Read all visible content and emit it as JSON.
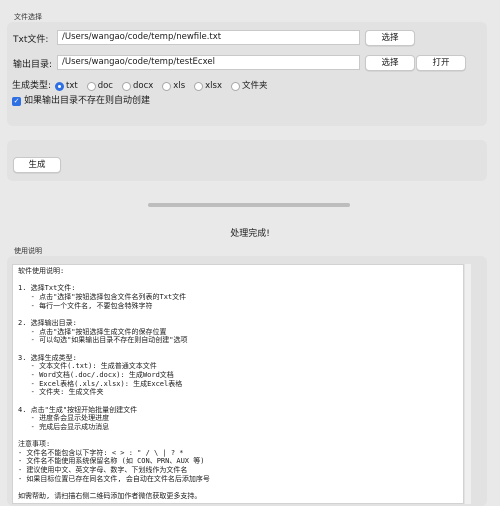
{
  "file_group": {
    "label": "文件选择",
    "txt_label": "Txt文件:",
    "txt_value": "/Users/wangao/code/temp/newfile.txt",
    "txt_browse": "选择",
    "out_label": "输出目录:",
    "out_value": "/Users/wangao/code/temp/testEcxel",
    "out_browse": "选择",
    "out_open": "打开",
    "type_label": "生成类型:",
    "types": [
      "txt",
      "doc",
      "docx",
      "xls",
      "xlsx",
      "文件夹"
    ],
    "selected_type": "txt",
    "auto_create_label": "如果输出目录不存在则自动创建",
    "auto_create_checked": true
  },
  "actions": {
    "generate": "生成"
  },
  "progress": {
    "value": 1.0
  },
  "status_text": "处理完成!",
  "help": {
    "label": "使用说明",
    "lines": [
      "软件使用说明:",
      "",
      "1. 选择Txt文件:",
      "   - 点击\"选择\"按钮选择包含文件名列表的Txt文件",
      "   - 每行一个文件名, 不要包含特殊字符",
      "",
      "2. 选择输出目录:",
      "   - 点击\"选择\"按钮选择生成文件的保存位置",
      "   - 可以勾选\"如果输出目录不存在则自动创建\"选项",
      "",
      "3. 选择生成类型:",
      "   - 文本文件(.txt): 生成普通文本文件",
      "   - Word文档(.doc/.docx): 生成Word文档",
      "   - Excel表格(.xls/.xlsx): 生成Excel表格",
      "   - 文件夹: 生成文件夹",
      "",
      "4. 点击\"生成\"按钮开始批量创建文件",
      "   - 进度条会显示处理进度",
      "   - 完成后会显示成功消息",
      "",
      "注意事项:",
      "- 文件名不能包含以下字符: < > : \" / \\ | ? *",
      "- 文件名不能使用系统保留名称 (如 CON、PRN、AUX 等)",
      "- 建议使用中文、英文字母、数字、下划线作为文件名",
      "- 如果目标位置已存在同名文件, 会自动在文件名后添加序号",
      "",
      "如需帮助, 请扫描右侧二维码添加作者微信获取更多支持。"
    ]
  },
  "colors": {
    "accent": "#2f6fe4",
    "window_bg": "#e9e9e9",
    "panel_bg": "#e2e2e2"
  }
}
